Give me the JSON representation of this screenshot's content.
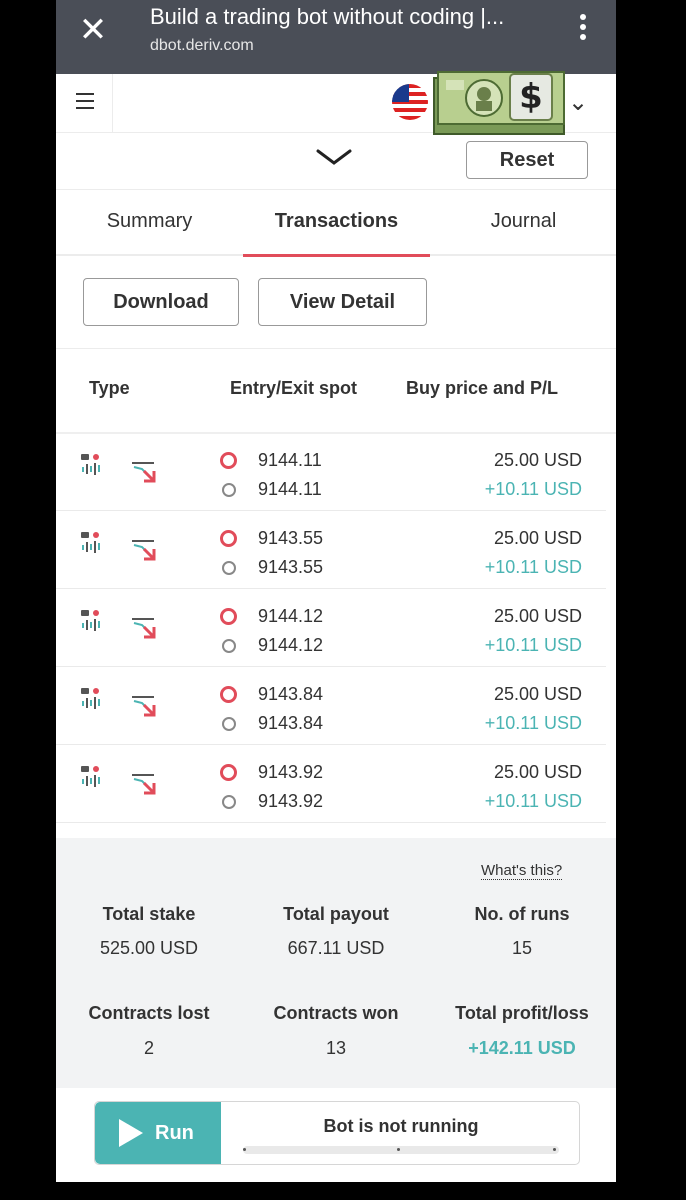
{
  "browser": {
    "title": "Build a trading bot without coding |...",
    "url": "dbot.deriv.com",
    "close_icon": "✕"
  },
  "header": {
    "menu_icon": "hamburger-icon",
    "flag_icon": "us-flag-icon",
    "account_icon": "money-bill-icon",
    "chevron": "⌄"
  },
  "toolbar": {
    "reset_label": "Reset",
    "download_label": "Download",
    "view_detail_label": "View Detail"
  },
  "tabs": [
    {
      "label": "Summary",
      "active": false
    },
    {
      "label": "Transactions",
      "active": true
    },
    {
      "label": "Journal",
      "active": false
    }
  ],
  "table": {
    "headers": [
      "Type",
      "Entry/Exit spot",
      "Buy price and P/L"
    ],
    "rows": [
      {
        "entry": "9144.11",
        "exit": "9144.11",
        "buy_price": "25.00 USD",
        "pl": "+10.11 USD"
      },
      {
        "entry": "9143.55",
        "exit": "9143.55",
        "buy_price": "25.00 USD",
        "pl": "+10.11 USD"
      },
      {
        "entry": "9144.12",
        "exit": "9144.12",
        "buy_price": "25.00 USD",
        "pl": "+10.11 USD"
      },
      {
        "entry": "9143.84",
        "exit": "9143.84",
        "buy_price": "25.00 USD",
        "pl": "+10.11 USD"
      },
      {
        "entry": "9143.92",
        "exit": "9143.92",
        "buy_price": "25.00 USD",
        "pl": "+10.11 USD"
      }
    ]
  },
  "summary": {
    "whats_this": "What's this?",
    "total_stake_label": "Total stake",
    "total_stake": "525.00 USD",
    "total_payout_label": "Total payout",
    "total_payout": "667.11 USD",
    "runs_label": "No. of runs",
    "runs": "15",
    "lost_label": "Contracts lost",
    "lost": "2",
    "won_label": "Contracts won",
    "won": "13",
    "profit_label": "Total profit/loss",
    "profit": "+142.11 USD"
  },
  "run": {
    "button_label": "Run",
    "status": "Bot is not running"
  },
  "colors": {
    "accent_red": "#e14c5a",
    "profit_teal": "#4bb4b3",
    "browser_bar": "#4a4e57"
  }
}
